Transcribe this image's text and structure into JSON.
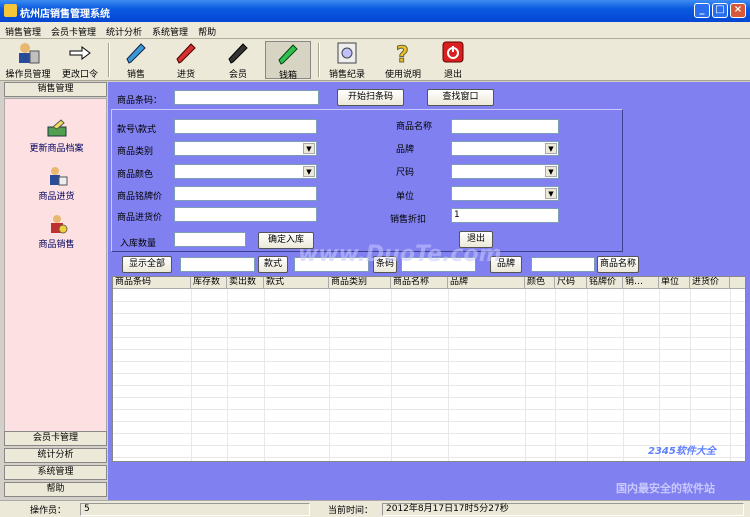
{
  "window": {
    "title": "杭州店销售管理系统"
  },
  "menu": [
    "销售管理",
    "会员卡管理",
    "统计分析",
    "系统管理",
    "帮助"
  ],
  "toolbar": {
    "items": [
      {
        "label": "操作员管理",
        "icon": "operator-manage-icon"
      },
      {
        "label": "更改口令",
        "icon": "change-password-icon"
      },
      {
        "label": "销售",
        "icon": "sale-pen-icon"
      },
      {
        "label": "进货",
        "icon": "purchase-pen-icon"
      },
      {
        "label": "会员",
        "icon": "member-pen-icon"
      },
      {
        "label": "钱箱",
        "icon": "cashbox-icon"
      },
      {
        "label": "销售纪录",
        "icon": "sales-record-icon"
      },
      {
        "label": "使用说明",
        "icon": "help-icon"
      },
      {
        "label": "退出",
        "icon": "exit-icon"
      }
    ]
  },
  "sidebar": {
    "header": "销售管理",
    "items": [
      {
        "label": "更新商品档案",
        "icon": "update-product-icon"
      },
      {
        "label": "商品进货",
        "icon": "product-purchase-icon"
      },
      {
        "label": "商品销售",
        "icon": "product-sale-icon"
      }
    ],
    "footer": [
      "会员卡管理",
      "统计分析",
      "系统管理",
      "帮助"
    ]
  },
  "form": {
    "barcode_label": "商品条码：",
    "barcode_value": "",
    "start_scan": "开始扫条码",
    "find_window": "查找窗口",
    "style_label": "款号\\款式",
    "category_label": "商品类别",
    "color_label": "商品颜色",
    "tag_price_label": "商品铭牌价",
    "purchase_price_label": "商品进货价",
    "qty_label": "入库数量",
    "confirm_stock": "确定入库",
    "name_label": "商品名称",
    "brand_label": "品牌",
    "size_label": "尺码",
    "unit_label": "单位",
    "discount_label": "销售折扣",
    "discount_value": "1",
    "exit": "退出"
  },
  "filter": {
    "show_all": "显示全部",
    "style": "款式",
    "barcode": "条码",
    "brand": "品牌",
    "product_name": "商品名称"
  },
  "grid": {
    "columns": [
      "商品条码",
      "库存数",
      "卖出数",
      "款式",
      "商品类别",
      "商品名称",
      "品牌",
      "颜色",
      "尺码",
      "铭牌价",
      "销…",
      "单位",
      "进货价"
    ]
  },
  "status": {
    "operator_label": "操作员：",
    "operator_value": "5",
    "time_label": "当前时间：",
    "time_value": "2012年8月17日17时5分27秒"
  },
  "watermark": {
    "text": "www.DuoTe.com",
    "brand": "2345软件大全",
    "slogan": "国内最安全的软件站"
  }
}
